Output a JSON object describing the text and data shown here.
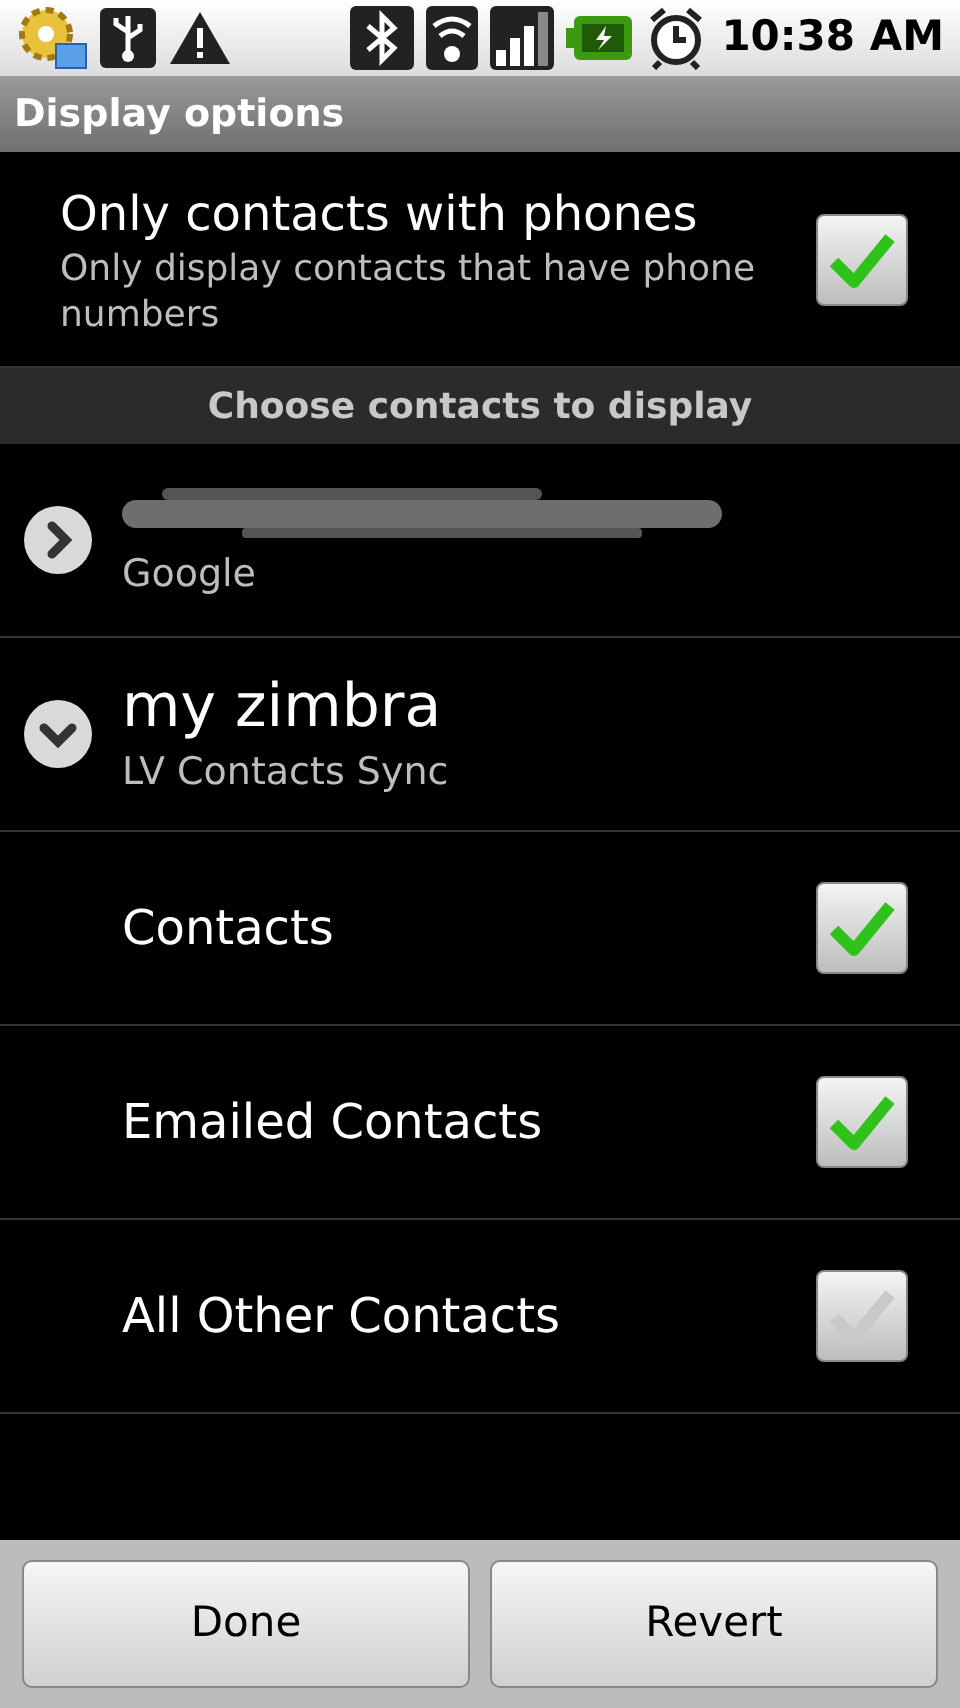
{
  "status_bar": {
    "time": "10:38 AM"
  },
  "title": "Display options",
  "phones_option": {
    "title": "Only contacts with phones",
    "summary": "Only display contacts that have phone numbers",
    "checked": true
  },
  "section_header": "Choose contacts to display",
  "accounts": [
    {
      "kind": "redacted",
      "type": "Google",
      "expanded": false
    },
    {
      "kind": "named",
      "name": "my zimbra",
      "type": "LV Contacts Sync",
      "expanded": true,
      "children": [
        {
          "label": "Contacts",
          "checked": true
        },
        {
          "label": "Emailed Contacts",
          "checked": true
        },
        {
          "label": "All Other Contacts",
          "checked": false
        }
      ]
    }
  ],
  "buttons": [
    "Done",
    "Revert"
  ]
}
